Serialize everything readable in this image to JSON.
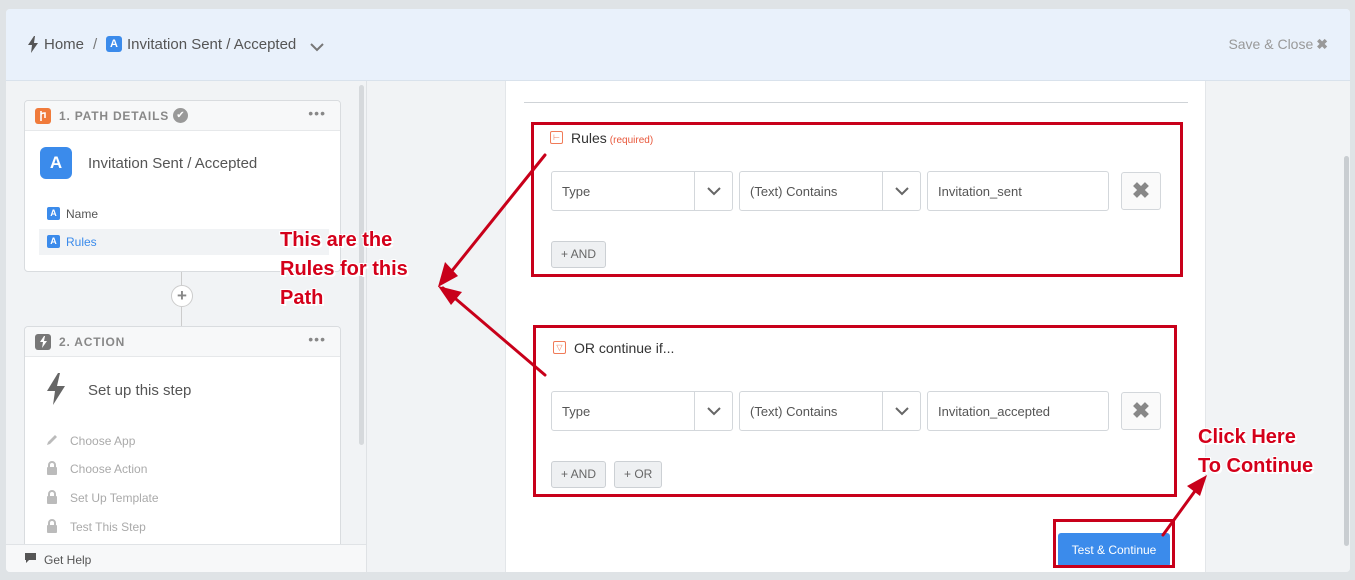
{
  "header": {
    "home": "Home",
    "separator": "/",
    "app_badge": "A",
    "title": "Invitation Sent / Accepted",
    "save_close": "Save & Close"
  },
  "sidebar": {
    "step1": {
      "title": "1. PATH DETAILS",
      "badge": "A",
      "name": "Invitation Sent / Accepted",
      "items": [
        {
          "label": "Name"
        },
        {
          "label": "Rules"
        }
      ]
    },
    "step2": {
      "title": "2. ACTION",
      "name": "Set up this step",
      "items": [
        {
          "label": "Choose App"
        },
        {
          "label": "Choose Action"
        },
        {
          "label": "Set Up Template"
        },
        {
          "label": "Test This Step"
        }
      ]
    },
    "get_help": "Get Help"
  },
  "rules": {
    "title": "Rules",
    "required": "(required)",
    "group1": {
      "field": "Type",
      "operator": "(Text) Contains",
      "value": "Invitation_sent",
      "and_button": "+ AND"
    },
    "or_title": "OR continue if...",
    "group2": {
      "field": "Type",
      "operator": "(Text) Contains",
      "value": "Invitation_accepted",
      "and_button": "+ AND",
      "or_button": "+ OR"
    },
    "test_continue": "Test & Continue"
  },
  "annotations": {
    "rules_note": [
      "This are the",
      "Rules for this",
      "Path"
    ],
    "continue_note": [
      "Click Here",
      "To Continue"
    ]
  },
  "colors": {
    "accent": "#3b8beb",
    "annotation_red": "#c8001a",
    "rule_icon": "#f07b58"
  }
}
